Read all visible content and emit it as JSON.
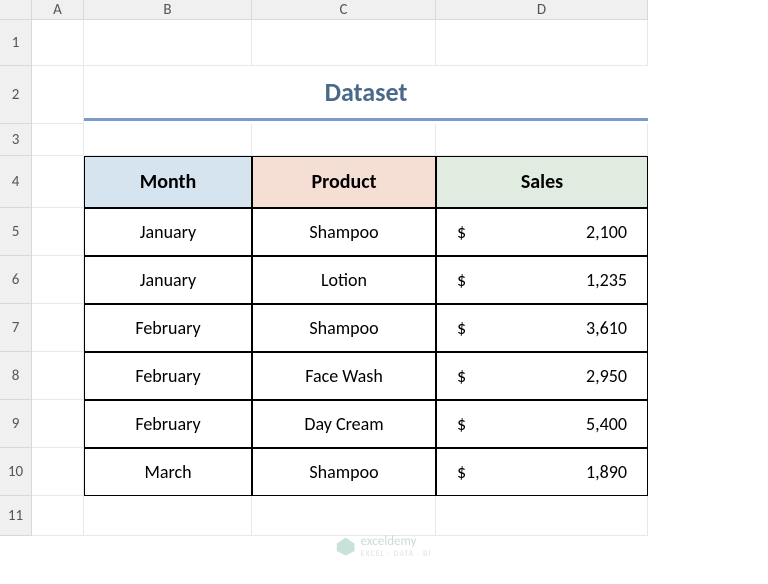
{
  "columns": [
    "A",
    "B",
    "C",
    "D"
  ],
  "rows": [
    "1",
    "2",
    "3",
    "4",
    "5",
    "6",
    "7",
    "8",
    "9",
    "10",
    "11"
  ],
  "title": "Dataset",
  "headers": {
    "month": "Month",
    "product": "Product",
    "sales": "Sales"
  },
  "currency": "$",
  "data": [
    {
      "month": "January",
      "product": "Shampoo",
      "sales": "2,100"
    },
    {
      "month": "January",
      "product": "Lotion",
      "sales": "1,235"
    },
    {
      "month": "February",
      "product": "Shampoo",
      "sales": "3,610"
    },
    {
      "month": "February",
      "product": "Face Wash",
      "sales": "2,950"
    },
    {
      "month": "February",
      "product": "Day Cream",
      "sales": "5,400"
    },
    {
      "month": "March",
      "product": "Shampoo",
      "sales": "1,890"
    }
  ],
  "watermark": {
    "brand": "exceldemy",
    "tagline": "EXCEL · DATA · BI"
  },
  "chart_data": {
    "type": "table",
    "title": "Dataset",
    "columns": [
      "Month",
      "Product",
      "Sales"
    ],
    "rows": [
      [
        "January",
        "Shampoo",
        2100
      ],
      [
        "January",
        "Lotion",
        1235
      ],
      [
        "February",
        "Shampoo",
        3610
      ],
      [
        "February",
        "Face Wash",
        2950
      ],
      [
        "February",
        "Day Cream",
        5400
      ],
      [
        "March",
        "Shampoo",
        1890
      ]
    ]
  }
}
